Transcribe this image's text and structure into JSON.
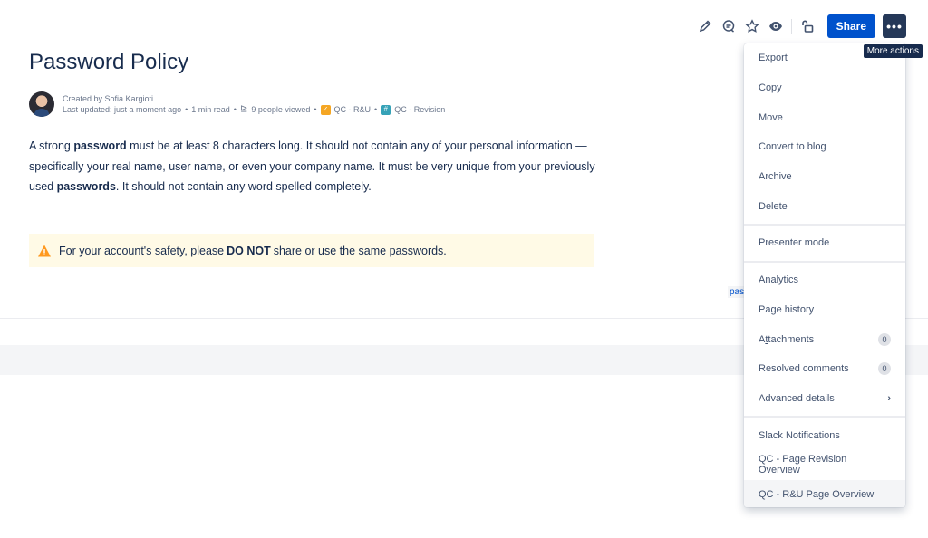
{
  "toolbar": {
    "icons": [
      "pencil-icon",
      "comment-icon",
      "star-icon",
      "eye-icon",
      "unlock-icon"
    ],
    "share_label": "Share",
    "more_label": "•••",
    "tooltip": "More actions"
  },
  "page": {
    "title": "Password Policy",
    "byline": {
      "created_by": "Created by Sofia Kargioti",
      "last_updated": "Last updated: just a moment ago",
      "read_time": "1 min read",
      "views": "9 people viewed",
      "app1": "QC - R&U",
      "app2": "QC - Revision"
    },
    "body": {
      "p1": "A strong ",
      "b1": "password",
      "p2": " must be at least 8 characters long. It should not contain any of your personal information —specifically your real name, user name, or even your company name. It must be very unique from your previously used ",
      "b2": "passwords",
      "p3": ". It should not contain any word spelled completely."
    },
    "warning": {
      "pre": "For your account's safety, please ",
      "bold": "DO NOT",
      "post": " share or use the same passwords."
    },
    "label_chip": "pas"
  },
  "menu": {
    "group1": [
      "Export",
      "Copy",
      "Move",
      "Convert to blog",
      "Archive",
      "Delete"
    ],
    "group2": [
      "Presenter mode"
    ],
    "analytics": "Analytics",
    "page_history": "Page history",
    "attachments_a": "A",
    "attachments_u": "t",
    "attachments_rest": "tachments",
    "attachments_count": "0",
    "resolved_comments": "Resolved comments",
    "resolved_count": "0",
    "advanced_details": "Advanced details",
    "advanced_chevron": "›",
    "group4": [
      "Slack Notifications",
      "QC - Page Revision Overview",
      "QC - R&U Page Overview"
    ],
    "export_chevron": "›"
  },
  "colors": {
    "primary": "#0052cc",
    "more_button": "#253858",
    "warning_bg": "#fffae6",
    "warning_icon": "#ff991f"
  }
}
